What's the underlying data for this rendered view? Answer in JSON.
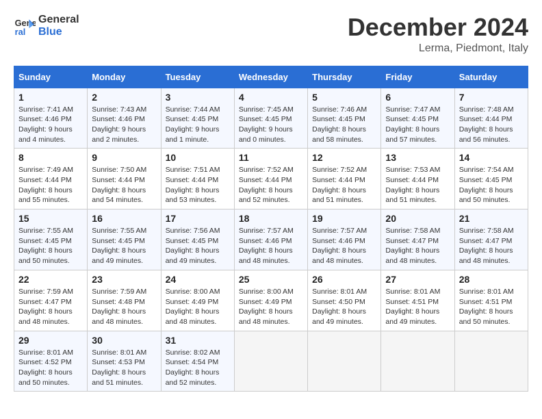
{
  "header": {
    "logo_line1": "General",
    "logo_line2": "Blue",
    "month_title": "December 2024",
    "location": "Lerma, Piedmont, Italy"
  },
  "days_of_week": [
    "Sunday",
    "Monday",
    "Tuesday",
    "Wednesday",
    "Thursday",
    "Friday",
    "Saturday"
  ],
  "weeks": [
    [
      {
        "day": "1",
        "info": "Sunrise: 7:41 AM\nSunset: 4:46 PM\nDaylight: 9 hours\nand 4 minutes."
      },
      {
        "day": "2",
        "info": "Sunrise: 7:43 AM\nSunset: 4:46 PM\nDaylight: 9 hours\nand 2 minutes."
      },
      {
        "day": "3",
        "info": "Sunrise: 7:44 AM\nSunset: 4:45 PM\nDaylight: 9 hours\nand 1 minute."
      },
      {
        "day": "4",
        "info": "Sunrise: 7:45 AM\nSunset: 4:45 PM\nDaylight: 9 hours\nand 0 minutes."
      },
      {
        "day": "5",
        "info": "Sunrise: 7:46 AM\nSunset: 4:45 PM\nDaylight: 8 hours\nand 58 minutes."
      },
      {
        "day": "6",
        "info": "Sunrise: 7:47 AM\nSunset: 4:45 PM\nDaylight: 8 hours\nand 57 minutes."
      },
      {
        "day": "7",
        "info": "Sunrise: 7:48 AM\nSunset: 4:44 PM\nDaylight: 8 hours\nand 56 minutes."
      }
    ],
    [
      {
        "day": "8",
        "info": "Sunrise: 7:49 AM\nSunset: 4:44 PM\nDaylight: 8 hours\nand 55 minutes."
      },
      {
        "day": "9",
        "info": "Sunrise: 7:50 AM\nSunset: 4:44 PM\nDaylight: 8 hours\nand 54 minutes."
      },
      {
        "day": "10",
        "info": "Sunrise: 7:51 AM\nSunset: 4:44 PM\nDaylight: 8 hours\nand 53 minutes."
      },
      {
        "day": "11",
        "info": "Sunrise: 7:52 AM\nSunset: 4:44 PM\nDaylight: 8 hours\nand 52 minutes."
      },
      {
        "day": "12",
        "info": "Sunrise: 7:52 AM\nSunset: 4:44 PM\nDaylight: 8 hours\nand 51 minutes."
      },
      {
        "day": "13",
        "info": "Sunrise: 7:53 AM\nSunset: 4:44 PM\nDaylight: 8 hours\nand 51 minutes."
      },
      {
        "day": "14",
        "info": "Sunrise: 7:54 AM\nSunset: 4:45 PM\nDaylight: 8 hours\nand 50 minutes."
      }
    ],
    [
      {
        "day": "15",
        "info": "Sunrise: 7:55 AM\nSunset: 4:45 PM\nDaylight: 8 hours\nand 50 minutes."
      },
      {
        "day": "16",
        "info": "Sunrise: 7:55 AM\nSunset: 4:45 PM\nDaylight: 8 hours\nand 49 minutes."
      },
      {
        "day": "17",
        "info": "Sunrise: 7:56 AM\nSunset: 4:45 PM\nDaylight: 8 hours\nand 49 minutes."
      },
      {
        "day": "18",
        "info": "Sunrise: 7:57 AM\nSunset: 4:46 PM\nDaylight: 8 hours\nand 48 minutes."
      },
      {
        "day": "19",
        "info": "Sunrise: 7:57 AM\nSunset: 4:46 PM\nDaylight: 8 hours\nand 48 minutes."
      },
      {
        "day": "20",
        "info": "Sunrise: 7:58 AM\nSunset: 4:47 PM\nDaylight: 8 hours\nand 48 minutes."
      },
      {
        "day": "21",
        "info": "Sunrise: 7:58 AM\nSunset: 4:47 PM\nDaylight: 8 hours\nand 48 minutes."
      }
    ],
    [
      {
        "day": "22",
        "info": "Sunrise: 7:59 AM\nSunset: 4:47 PM\nDaylight: 8 hours\nand 48 minutes."
      },
      {
        "day": "23",
        "info": "Sunrise: 7:59 AM\nSunset: 4:48 PM\nDaylight: 8 hours\nand 48 minutes."
      },
      {
        "day": "24",
        "info": "Sunrise: 8:00 AM\nSunset: 4:49 PM\nDaylight: 8 hours\nand 48 minutes."
      },
      {
        "day": "25",
        "info": "Sunrise: 8:00 AM\nSunset: 4:49 PM\nDaylight: 8 hours\nand 48 minutes."
      },
      {
        "day": "26",
        "info": "Sunrise: 8:01 AM\nSunset: 4:50 PM\nDaylight: 8 hours\nand 49 minutes."
      },
      {
        "day": "27",
        "info": "Sunrise: 8:01 AM\nSunset: 4:51 PM\nDaylight: 8 hours\nand 49 minutes."
      },
      {
        "day": "28",
        "info": "Sunrise: 8:01 AM\nSunset: 4:51 PM\nDaylight: 8 hours\nand 50 minutes."
      }
    ],
    [
      {
        "day": "29",
        "info": "Sunrise: 8:01 AM\nSunset: 4:52 PM\nDaylight: 8 hours\nand 50 minutes."
      },
      {
        "day": "30",
        "info": "Sunrise: 8:01 AM\nSunset: 4:53 PM\nDaylight: 8 hours\nand 51 minutes."
      },
      {
        "day": "31",
        "info": "Sunrise: 8:02 AM\nSunset: 4:54 PM\nDaylight: 8 hours\nand 52 minutes."
      },
      {
        "day": "",
        "info": ""
      },
      {
        "day": "",
        "info": ""
      },
      {
        "day": "",
        "info": ""
      },
      {
        "day": "",
        "info": ""
      }
    ]
  ]
}
